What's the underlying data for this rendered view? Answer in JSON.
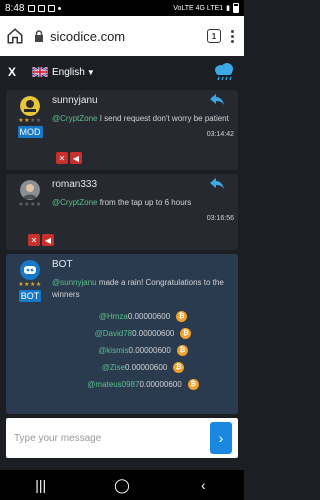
{
  "status": {
    "time": "8:48",
    "network": "VoLTE 4G LTE1"
  },
  "browser": {
    "url": "sicodice.com",
    "tab_count": "1"
  },
  "topbar": {
    "close": "X",
    "language": "English"
  },
  "messages": [
    {
      "username": "sunnyjanu",
      "role": "MOD",
      "stars": 2,
      "mention": "@CryptZone",
      "text": " I send request don't worry be patient",
      "time": "03:14:42"
    },
    {
      "username": "roman333",
      "role": "",
      "stars": 0,
      "mention": "@CryptZone",
      "text": " from the tap up to 6 hours",
      "time": "03:16:56"
    }
  ],
  "bot": {
    "username": "BOT",
    "role": "BOT",
    "mention": "@sunnyjanu",
    "text": " made a rain! Congratulations to the winners",
    "winners": [
      {
        "name": "@Hmza",
        "amount": " 0.00000600"
      },
      {
        "name": "@David78",
        "amount": "0.00000600"
      },
      {
        "name": "@kismis",
        "amount": "0.00000600"
      },
      {
        "name": "@Zise",
        "amount": "0.00000600"
      },
      {
        "name": "@mateus0987",
        "amount": "0.00000600"
      }
    ]
  },
  "composer": {
    "placeholder": "Type your message"
  },
  "colors": {
    "accent": "#1a88e0",
    "mention": "#59c08a",
    "coin": "#f2a12b",
    "mod_btn": "#c9302c"
  }
}
